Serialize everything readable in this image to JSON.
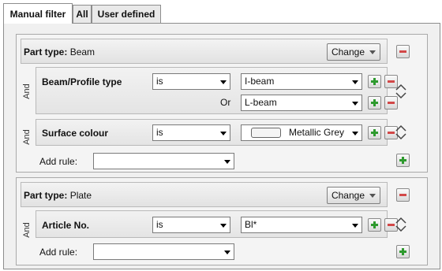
{
  "tabs": [
    {
      "label": "Manual filter",
      "active": true
    },
    {
      "label": "All",
      "active": false
    },
    {
      "label": "User defined",
      "active": false
    }
  ],
  "group1": {
    "part_type_label": "Part type:",
    "part_type_value": "Beam",
    "change_label": "Change",
    "rules": [
      {
        "connector": "And",
        "label": "Beam/Profile type",
        "operator": "is",
        "value": "I-beam",
        "or_label": "Or",
        "or_value": "L-beam"
      },
      {
        "connector": "And",
        "label": "Surface colour",
        "operator": "is",
        "value": "Metallic Grey"
      }
    ],
    "add_rule_label": "Add rule:",
    "add_rule_value": ""
  },
  "group2": {
    "part_type_label": "Part type:",
    "part_type_value": "Plate",
    "change_label": "Change",
    "rules": [
      {
        "connector": "And",
        "label": "Article No.",
        "operator": "is",
        "value": "Bl*"
      }
    ],
    "add_rule_label": "Add rule:",
    "add_rule_value": ""
  },
  "colors": {
    "add_green": "#2e9a2e",
    "remove_red": "#d24848",
    "panel_bg": "#f0f0f0",
    "header_bg": "#e6e6e6"
  },
  "icons": [
    "plus-icon",
    "minus-icon",
    "move-up-down-icon",
    "dropdown-arrow-icon"
  ]
}
